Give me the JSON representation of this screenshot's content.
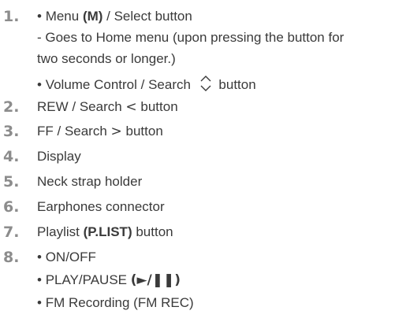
{
  "items": [
    {
      "number": "1.",
      "lines": [
        {
          "bullet": "•",
          "pre": "Menu ",
          "bold": "(M)",
          "post": " / Select button"
        },
        {
          "text": "- Goes to Home menu (upon pressing the button for"
        },
        {
          "text": "two seconds or longer.)"
        },
        {
          "bullet": "•",
          "pre": "Volume Control / Search",
          "icon": "up-down-chevron-icon",
          "post": "button"
        }
      ]
    },
    {
      "number": "2.",
      "pre": "REW / Search ",
      "glyph": "<",
      "post": " button"
    },
    {
      "number": "3.",
      "pre": "FF / Search ",
      "glyph": ">",
      "post": " button"
    },
    {
      "number": "4.",
      "text": "Display"
    },
    {
      "number": "5.",
      "text": "Neck strap holder"
    },
    {
      "number": "6.",
      "text": "Earphones connector"
    },
    {
      "number": "7.",
      "pre": "Playlist ",
      "bold": "(P.LIST)",
      "post": " button"
    },
    {
      "number": "8.",
      "lines": [
        {
          "bullet": "•",
          "text": "ON/OFF"
        },
        {
          "bullet": "•",
          "pre": "PLAY/PAUSE ",
          "bold": "(►/❚❚)"
        },
        {
          "bullet": "•",
          "text": "FM Recording (FM REC)"
        }
      ]
    }
  ]
}
